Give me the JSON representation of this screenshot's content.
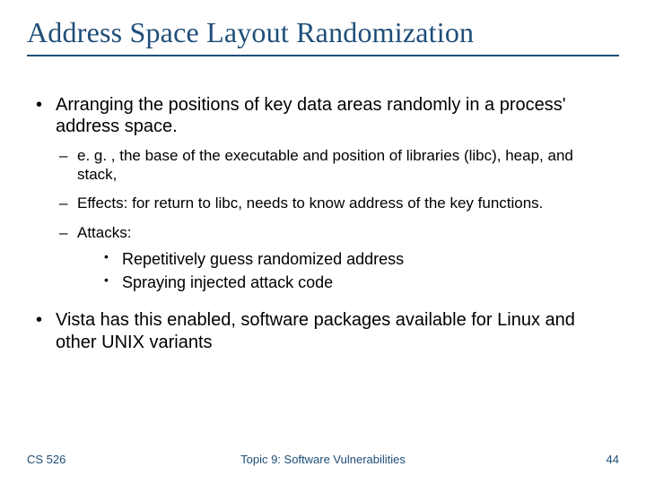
{
  "title": "Address Space Layout Randomization",
  "bullets": {
    "b1": "Arranging the positions of key data areas randomly in a process' address space.",
    "b1_subs": {
      "s1": "e. g. , the base of the executable and position of libraries (libc), heap, and stack,",
      "s2": "Effects: for return to libc, needs to know address of the key functions.",
      "s3": "Attacks:",
      "s3_subs": {
        "a1": "Repetitively guess randomized address",
        "a2": "Spraying injected attack code"
      }
    },
    "b2": "Vista has this enabled, software packages available for Linux and other UNIX variants"
  },
  "footer": {
    "left": "CS 526",
    "center": "Topic 9: Software Vulnerabilities",
    "right": "44"
  }
}
